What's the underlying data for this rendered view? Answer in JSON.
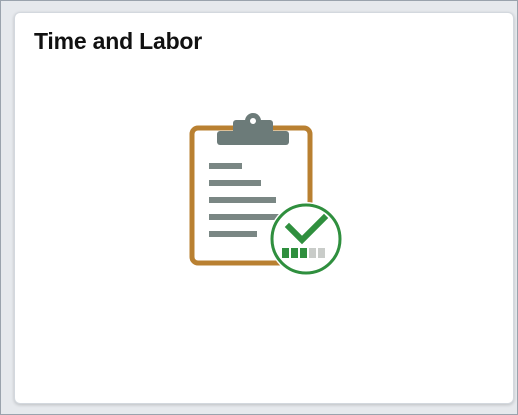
{
  "tile": {
    "title": "Time and Labor",
    "icon": "clipboard-check-icon"
  },
  "colors": {
    "clipboard_border": "#b98031",
    "clip_gray": "#6c7b79",
    "line_gray": "#7a8784",
    "check_green": "#2f8f3e",
    "progress_light": "#c9ccc9",
    "background": "#e3e7ec"
  },
  "progress": {
    "completed_segments": 3,
    "total_segments": 5
  }
}
